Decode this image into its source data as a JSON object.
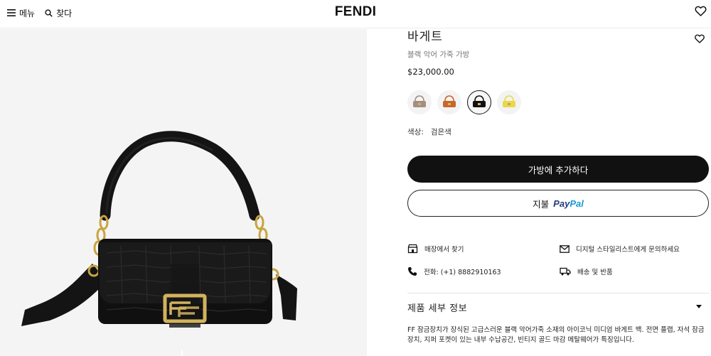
{
  "header": {
    "menu_label": "메뉴",
    "search_label": "찾다",
    "logo": "FENDI"
  },
  "product": {
    "name": "바게트",
    "subtitle": "블랙 악어 가죽 가방",
    "price": "$23,000.00",
    "swatches": [
      {
        "name": "taupe",
        "color": "#a48e82",
        "selected": false
      },
      {
        "name": "orange-brown",
        "color": "#c9652a",
        "selected": false
      },
      {
        "name": "black",
        "color": "#111111",
        "selected": true
      },
      {
        "name": "yellow",
        "color": "#e8d84a",
        "selected": false
      }
    ],
    "color_label": "색상:",
    "color_value": "검은색"
  },
  "actions": {
    "add_to_bag": "가방에 추가하다",
    "paypal_label": "지불",
    "paypal_logo_pay": "Pay",
    "paypal_logo_pal": "Pal"
  },
  "services": {
    "find_in_store": "매장에서 찾기",
    "contact_stylist": "디지털 스타일리스트에게 문의하세요",
    "phone": "전화: (+1) 8882910163",
    "shipping_returns": "배송 및 반품"
  },
  "details": {
    "section_title": "제품 세부 정보",
    "description": "FF 잠금장치가 장식된 고급스러운 블랙 악어가죽 소재의 아이코닉 미디엄 바게트 백. 전면 플랩, 자석 잠금장치, 지퍼 포켓이 있는 내부 수납공간, 빈티지 골드 마감 메탈웨어가 특징입니다."
  },
  "colors": {
    "primary_button": "#111111",
    "image_background": "#f4f4f4",
    "paypal_blue_dark": "#253b80",
    "paypal_blue_light": "#179bd7"
  }
}
